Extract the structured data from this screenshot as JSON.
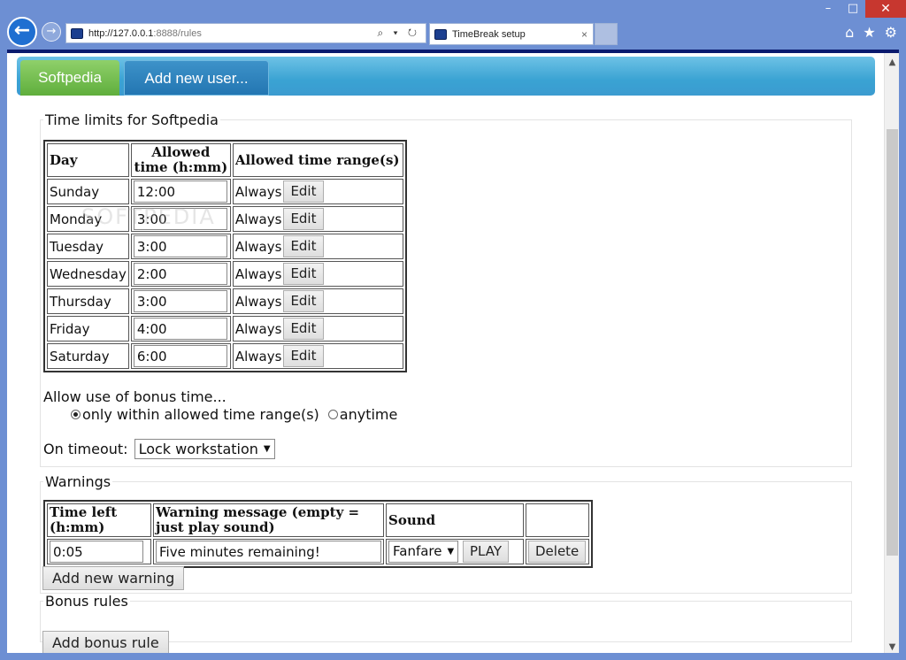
{
  "browser": {
    "window_controls": {
      "minimize": "–",
      "maximize": "□",
      "close": "✕"
    },
    "address": {
      "host": "http://127.0.0.1",
      "rest": ":8888/rules",
      "tools": "⌕ ▾ ↻"
    },
    "tab": {
      "title": "TimeBreak setup",
      "close": "×"
    },
    "right_tools": {
      "home": "⌂",
      "favorites": "★",
      "settings": "⚙"
    }
  },
  "page_tabs": [
    {
      "label": "Softpedia",
      "active": true
    },
    {
      "label": "Add new user...",
      "active": false
    }
  ],
  "limits": {
    "legend": "Time limits for Softpedia",
    "headers": {
      "day": "Day",
      "allowed_time": "Allowed time (h:mm)",
      "range": "Allowed time range(s)"
    },
    "rows": [
      {
        "day": "Sunday",
        "time": "12:00",
        "range": "Always",
        "edit": "Edit"
      },
      {
        "day": "Monday",
        "time": "3:00",
        "range": "Always",
        "edit": "Edit"
      },
      {
        "day": "Tuesday",
        "time": "3:00",
        "range": "Always",
        "edit": "Edit"
      },
      {
        "day": "Wednesday",
        "time": "2:00",
        "range": "Always",
        "edit": "Edit"
      },
      {
        "day": "Thursday",
        "time": "3:00",
        "range": "Always",
        "edit": "Edit"
      },
      {
        "day": "Friday",
        "time": "4:00",
        "range": "Always",
        "edit": "Edit"
      },
      {
        "day": "Saturday",
        "time": "6:00",
        "range": "Always",
        "edit": "Edit"
      }
    ],
    "bonus_question": "Allow use of bonus time...",
    "bonus_options": [
      {
        "label": "only within allowed time range(s)",
        "checked": true
      },
      {
        "label": "anytime",
        "checked": false
      }
    ],
    "timeout_label": "On timeout:",
    "timeout_value": "Lock workstation"
  },
  "warnings": {
    "legend": "Warnings",
    "headers": {
      "time_left": "Time left (h:mm)",
      "message": "Warning message (empty = just play sound)",
      "sound": "Sound"
    },
    "rows": [
      {
        "time_left": "0:05",
        "message": "Five minutes remaining!",
        "sound": "Fanfare",
        "play": "PLAY",
        "delete": "Delete"
      }
    ],
    "add_button": "Add new warning"
  },
  "bonus_rules": {
    "legend": "Bonus rules",
    "add_button": "Add bonus rule"
  },
  "watermark": "SOFTPEDIA"
}
